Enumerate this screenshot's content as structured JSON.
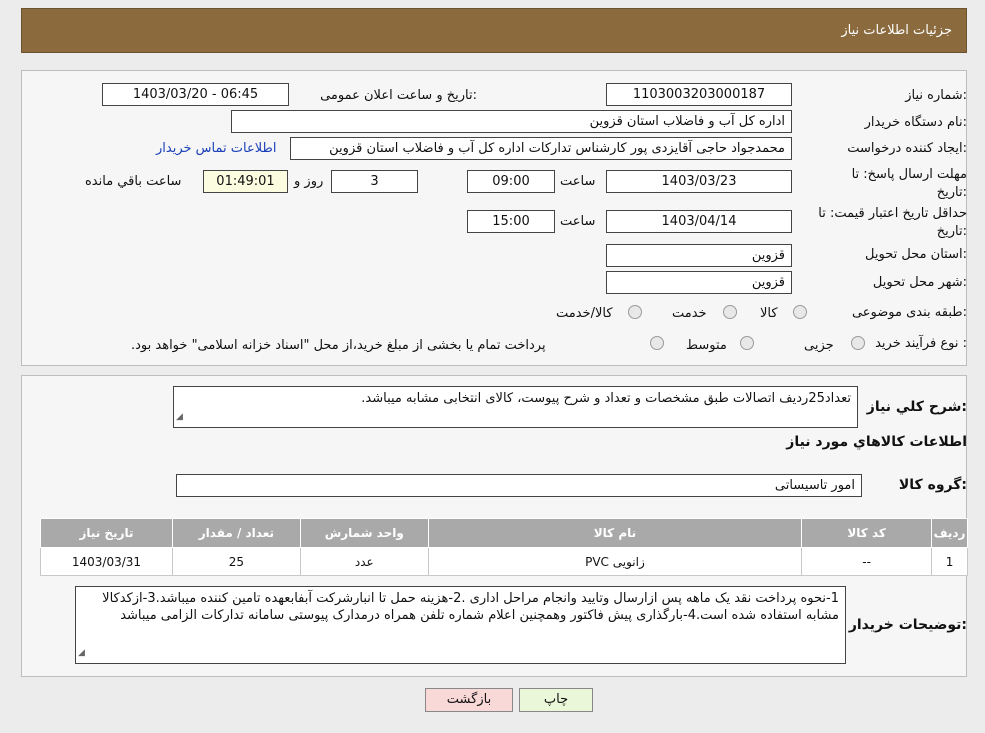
{
  "header": {
    "title": "جزئیات اطلاعات نیاز"
  },
  "form": {
    "need_number_label": "شماره نیاز:",
    "need_number": "1103003203000187",
    "announce_label": "تاریخ و ساعت اعلان عمومی:",
    "announce_value": "1403/03/20 - 06:45",
    "buyer_org_label": "نام دستگاه خریدار:",
    "buyer_org": "اداره کل آب و فاضلاب استان قزوین",
    "creator_label": "ایجاد کننده درخواست:",
    "creator": "محمدجواد حاجی آقایزدی پور کارشناس تدارکات اداره کل آب و فاضلاب استان قزوین",
    "contact_link": "اطلاعات تماس خریدار",
    "deadline_label_1": "مهلت ارسال پاسخ: تا",
    "deadline_label_2": "تاریخ:",
    "deadline_date": "1403/03/23",
    "time_label": "ساعت",
    "deadline_time": "09:00",
    "days_value": "3",
    "days_label": "روز و",
    "remaining_time": "01:49:01",
    "remaining_label": "ساعت باقي مانده",
    "validity_label_1": "حداقل تاريخ اعتبار قيمت: تا",
    "validity_label_2": "تاريخ:",
    "validity_date": "1403/04/14",
    "validity_time": "15:00",
    "province_label": "استان محل تحویل:",
    "province": "قزوین",
    "city_label": "شهر محل تحویل:",
    "city": "قزوین",
    "category_label": "طبقه بندی موضوعی:",
    "category_options": [
      "کالا",
      "خدمت",
      "کالا/خدمت"
    ],
    "process_label": "نوع فرآیند خرید :",
    "process_options": [
      "جزیی",
      "متوسط"
    ],
    "process_note": "پرداخت تمام یا بخشی از مبلغ خرید،از محل \"اسناد خزانه اسلامی\" خواهد بود."
  },
  "details": {
    "summary_label": "شرح کلي نياز:",
    "summary": "تعداد25ردیف اتصالات طبق مشخصات و تعداد و شرح پیوست، کالای انتخابی مشابه میباشد.",
    "goods_title": "اطلاعات کالاهاي مورد نياز",
    "group_label": "گروه کالا:",
    "group_value": "امور تاسیساتی",
    "table": {
      "headers": [
        "رديف",
        "کد کالا",
        "نام کالا",
        "واحد شمارش",
        "تعداد / مقدار",
        "تاریخ نیاز"
      ],
      "rows": [
        [
          "1",
          "--",
          "زانویی PVC",
          "عدد",
          "25",
          "1403/03/31"
        ]
      ]
    },
    "buyer_notes_label": "توضیحات خریدار:",
    "buyer_notes": "1-نحوه پرداخت نقد یک ماهه پس ازارسال وتایید وانجام مراحل اداری .2-هزینه حمل تا انبارشرکت آبفابعهده تامین کننده میباشد.3-ازکدکالا مشابه استفاده شده است.4-بارگذاری پیش فاکتور وهمچنین اعلام شماره تلفن همراه درمدارک پیوستی سامانه تدارکات الزامی میباشد"
  },
  "buttons": {
    "print": "چاپ",
    "back": "بازگشت"
  },
  "colors": {
    "header_bg": "#8b6a3e",
    "link": "#1a3fb8",
    "back_bg": "#f9d8d8",
    "print_bg": "#eaf7d9"
  }
}
